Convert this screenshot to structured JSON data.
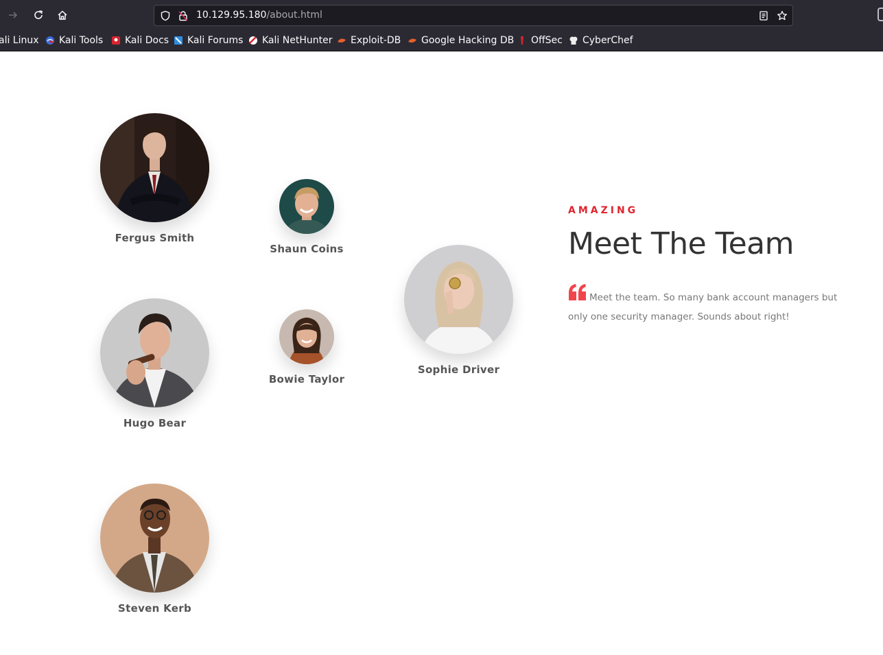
{
  "browser": {
    "url_host": "10.129.95.180",
    "url_path": "/about.html",
    "bookmarks": [
      {
        "label": "ali Linux",
        "icon": "kali-icon"
      },
      {
        "label": "Kali Tools",
        "icon": "kali-tools-icon"
      },
      {
        "label": "Kali Docs",
        "icon": "kali-docs-icon"
      },
      {
        "label": "Kali Forums",
        "icon": "kali-forums-icon"
      },
      {
        "label": "Kali NetHunter",
        "icon": "kali-nethunter-icon"
      },
      {
        "label": "Exploit-DB",
        "icon": "exploit-db-icon"
      },
      {
        "label": "Google Hacking DB",
        "icon": "ghdb-icon"
      },
      {
        "label": "OffSec",
        "icon": "offsec-icon"
      },
      {
        "label": "CyberChef",
        "icon": "cyberchef-icon"
      }
    ]
  },
  "team": {
    "eyebrow": "AMAZING",
    "title": "Meet The Team",
    "quote": "Meet the team. So many bank account managers but only one security manager. Sounds about right!",
    "accent_color": "#e0252f",
    "members": [
      {
        "name": "Fergus Smith"
      },
      {
        "name": "Shaun Coins"
      },
      {
        "name": "Hugo Bear"
      },
      {
        "name": "Bowie Taylor"
      },
      {
        "name": "Sophie Driver"
      },
      {
        "name": "Steven Kerb"
      }
    ]
  }
}
